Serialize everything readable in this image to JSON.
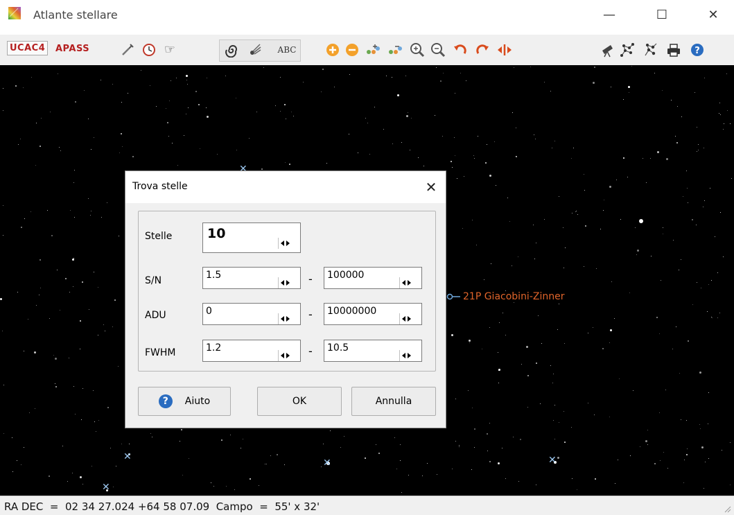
{
  "window": {
    "title": "Atlante stellare",
    "minimize_glyph": "—",
    "maximize_glyph": "☐",
    "close_glyph": "✕"
  },
  "toolbar": {
    "catalog_ucac": "UCAC4",
    "catalog_apass": "APASS",
    "icons": [
      "wrench-icon",
      "clock-icon",
      "pointer-hand-icon",
      "spiral-galaxy-icon",
      "comet-icon",
      "abc-labels-icon",
      "zoom-plus-icon",
      "zoom-minus-icon",
      "grid-plus-icon",
      "grid-minus-icon",
      "magnify-plus-icon",
      "magnify-minus-icon",
      "rotate-left-icon",
      "rotate-right-icon",
      "flip-horizontal-icon",
      "telescope-icon",
      "constellation-icon",
      "star-chart-icon",
      "printer-icon",
      "help-icon"
    ],
    "abc_label": "ABC"
  },
  "sky": {
    "comet_label": "21P Giacobini-Zinner",
    "comet_color": "#e0642a",
    "background": "#000000"
  },
  "dialog": {
    "title": "Trova stelle",
    "close_glyph": "✕",
    "rows": {
      "stelle": {
        "label": "Stelle",
        "value": "10"
      },
      "sn": {
        "label": "S/N",
        "min": "1.5",
        "max": "100000"
      },
      "adu": {
        "label": "ADU",
        "min": "0",
        "max": "10000000"
      },
      "fwhm": {
        "label": "FWHM",
        "min": "1.2",
        "max": "10.5"
      }
    },
    "range_separator": "-",
    "buttons": {
      "help": "Aiuto",
      "help_glyph": "?",
      "ok": "OK",
      "cancel": "Annulla"
    }
  },
  "status": {
    "text": "RA DEC  =  02 34 27.024 +64 58 07.09  Campo  =  55' x 32'"
  }
}
